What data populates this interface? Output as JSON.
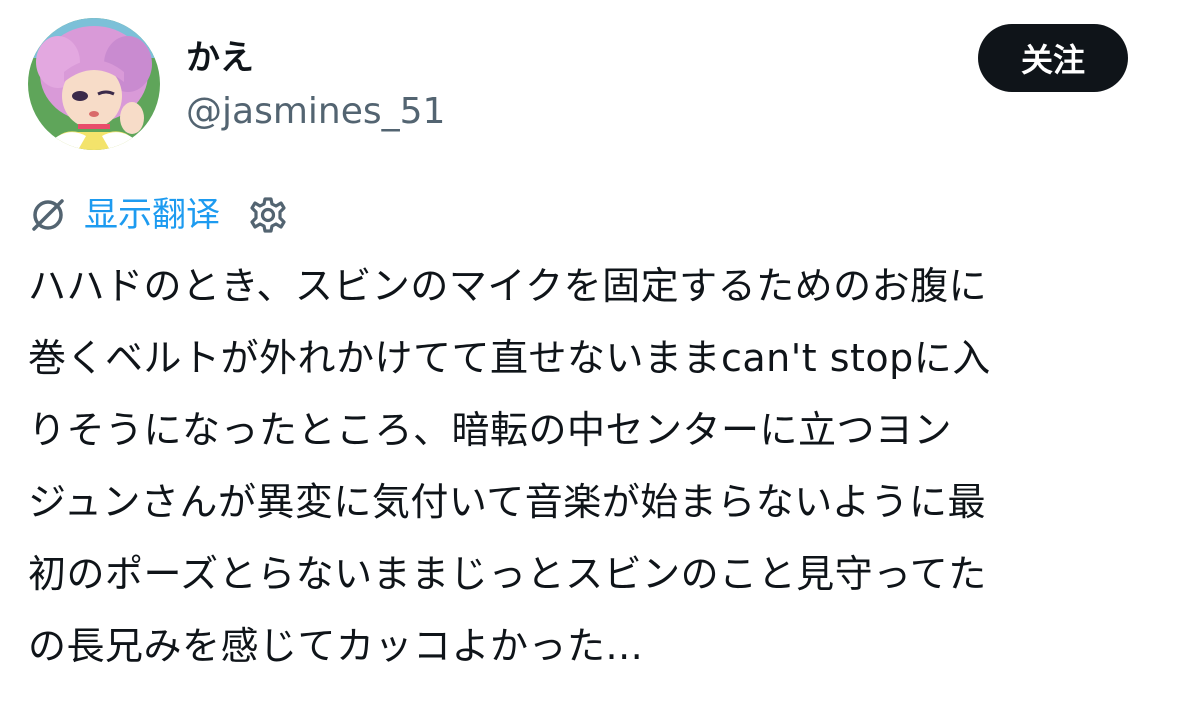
{
  "author": {
    "display_name": "かえ",
    "handle": "@jasmines_51",
    "avatar_icon": "anime-girl-avatar"
  },
  "actions": {
    "follow_label": "关注"
  },
  "translation": {
    "icon": "globe-slash-icon",
    "label": "显示翻译",
    "settings_icon": "gear-icon"
  },
  "tweet": {
    "lines": [
      "ハハドのとき、スビンのマイクを固定するためのお腹に",
      "巻くベルトが外れかけてて直せないままcan't stopに入",
      "りそうになったところ、暗転の中センターに立つヨン",
      "ジュンさんが異変に気付いて音楽が始まらないように最",
      "初のポーズとらないままじっとスビンのこと見守ってた",
      "の長兄みを感じてカッコよかった..."
    ]
  },
  "colors": {
    "link": "#1d9bf0",
    "handle": "#536471",
    "button_bg": "#0f1419",
    "text": "#0f1419"
  }
}
